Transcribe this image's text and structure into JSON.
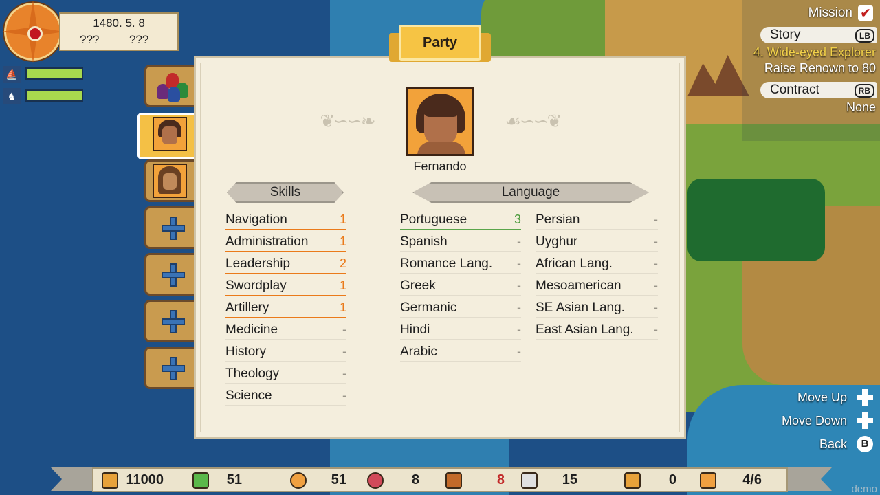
{
  "date": {
    "date_text": "1480. 5. 8",
    "unknown_1": "???",
    "unknown_2": "???"
  },
  "fleet_icons": [
    "ship-icon",
    "caravan-icon"
  ],
  "party": {
    "title": "Party",
    "character_name": "Fernando",
    "skills_header": "Skills",
    "language_header": "Language",
    "skills": [
      {
        "name": "Navigation",
        "value": "1"
      },
      {
        "name": "Administration",
        "value": "1"
      },
      {
        "name": "Leadership",
        "value": "2"
      },
      {
        "name": "Swordplay",
        "value": "1"
      },
      {
        "name": "Artillery",
        "value": "1"
      },
      {
        "name": "Medicine",
        "value": "-"
      },
      {
        "name": "History",
        "value": "-"
      },
      {
        "name": "Theology",
        "value": "-"
      },
      {
        "name": "Science",
        "value": "-"
      }
    ],
    "languages_col1": [
      {
        "name": "Portuguese",
        "value": "3"
      },
      {
        "name": "Spanish",
        "value": "-"
      },
      {
        "name": "Romance Lang.",
        "value": "-"
      },
      {
        "name": "Greek",
        "value": "-"
      },
      {
        "name": "Germanic",
        "value": "-"
      },
      {
        "name": "Hindi",
        "value": "-"
      },
      {
        "name": "Arabic",
        "value": "-"
      }
    ],
    "languages_col2": [
      {
        "name": "Persian",
        "value": "-"
      },
      {
        "name": "Uyghur",
        "value": "-"
      },
      {
        "name": "African Lang.",
        "value": "-"
      },
      {
        "name": "Mesoamerican",
        "value": "-"
      },
      {
        "name": "SE Asian Lang.",
        "value": "-"
      },
      {
        "name": "East Asian Lang.",
        "value": "-"
      }
    ]
  },
  "mission": {
    "label": "Mission",
    "story_label": "Story",
    "story_key": "LB",
    "story_title": "4. Wide-eyed Explorer",
    "story_goal": "Raise Renown to 80",
    "contract_label": "Contract",
    "contract_key": "RB",
    "contract_value": "None"
  },
  "controls": {
    "move_up": "Move Up",
    "move_down": "Move Down",
    "back": "Back",
    "back_key": "B"
  },
  "resources": {
    "gold": "11000",
    "supplies": "51",
    "food": "51",
    "meat": "8",
    "wood": "8",
    "crew": "15",
    "goods": "0",
    "cargo": "4/6"
  },
  "watermark": "demo",
  "colors": {
    "accent": "#f6c444",
    "highlight_orange": "#ea7a1a",
    "highlight_green": "#4a9a3a",
    "story_yellow": "#f2d14a"
  }
}
